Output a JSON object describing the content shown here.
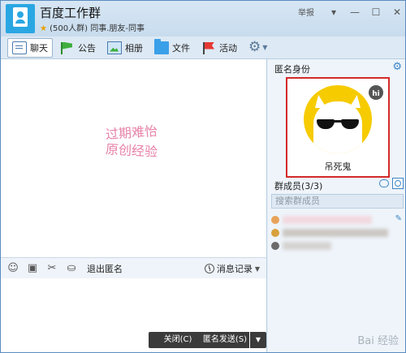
{
  "window": {
    "title": "百度工作群",
    "subtitle_count": "(500人群)",
    "subtitle_tags": "同事.朋友-同事",
    "report_label": "举报"
  },
  "toolbar": {
    "items": [
      {
        "label": "聊天",
        "icon": "chat-icon",
        "active": true
      },
      {
        "label": "公告",
        "icon": "notice-flag-icon"
      },
      {
        "label": "相册",
        "icon": "album-icon"
      },
      {
        "label": "文件",
        "icon": "folder-icon"
      },
      {
        "label": "活动",
        "icon": "event-flag-icon"
      }
    ],
    "settings_icon": "gear-icon"
  },
  "chat": {
    "watermark_line1": "过期难怡",
    "watermark_line2": "原创经验"
  },
  "chat_tools": {
    "exit_anonymous_label": "退出匿名",
    "history_label": "消息记录"
  },
  "buttons": {
    "close_label": "关闭(C)",
    "anon_send_label": "匿名发送(S)"
  },
  "right_panel": {
    "anon_title": "匿名身份",
    "anon_name": "吊死鬼",
    "hi_badge": "hi",
    "members_title": "群成员(3/3)",
    "search_placeholder": "搜索群成员"
  },
  "colors": {
    "accent": "#3b85c6",
    "highlight_border": "#d42a2a",
    "avatar_bg": "#f6cb00"
  }
}
